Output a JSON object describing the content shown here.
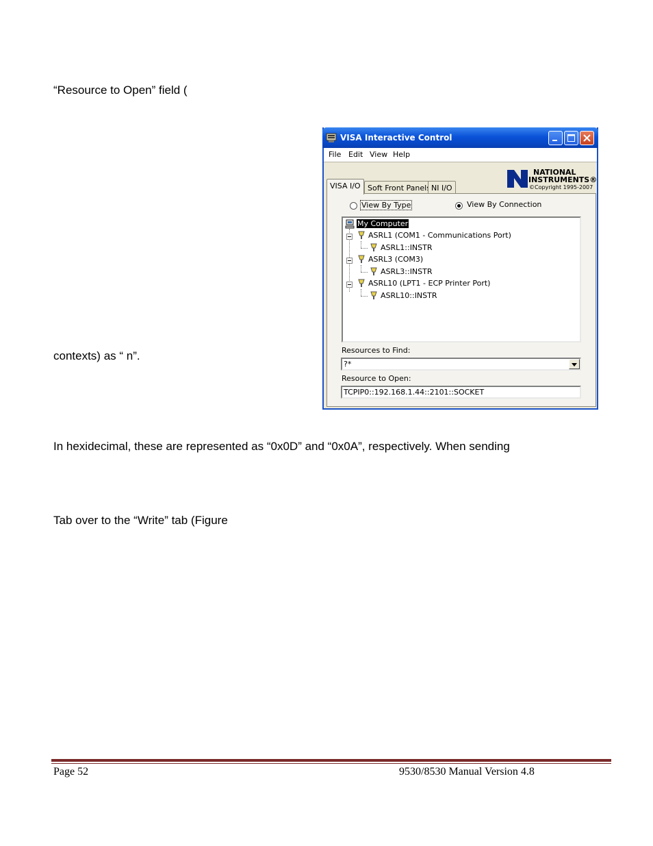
{
  "document": {
    "para1": "“Resource to Open” field (",
    "para2": "contexts) as “   n”.",
    "para3": "In hexidecimal, these are represented as “0x0D” and “0x0A”, respectively.  When sending",
    "para4": "Tab over to the “Write” tab (Figure"
  },
  "window": {
    "title": "VISA Interactive Control",
    "menu": [
      "File",
      "Edit",
      "View",
      "Help"
    ],
    "logo": {
      "line1": "NATIONAL",
      "line2": "INSTRUMENTS®",
      "copyright": "©Copyright 1995-2007"
    },
    "tabs": [
      {
        "label": "VISA I/O",
        "active": true
      },
      {
        "label": "Soft Front Panels",
        "active": false
      },
      {
        "label": "NI I/O",
        "active": false
      }
    ],
    "radios": [
      {
        "label": "View By Type",
        "selected": false
      },
      {
        "label": "View By Connection",
        "selected": true
      }
    ],
    "tree": [
      {
        "label": "My Computer",
        "icon": "computer-icon",
        "selected": true
      },
      {
        "label": "ASRL1  (COM1 - Communications Port)",
        "icon": "serial-connector-icon"
      },
      {
        "label": "ASRL1::INSTR",
        "icon": "instrument-icon"
      },
      {
        "label": "ASRL3  (COM3)",
        "icon": "serial-connector-icon"
      },
      {
        "label": "ASRL3::INSTR",
        "icon": "instrument-icon"
      },
      {
        "label": "ASRL10  (LPT1 - ECP Printer Port)",
        "icon": "serial-connector-icon"
      },
      {
        "label": "ASRL10::INSTR",
        "icon": "instrument-icon"
      }
    ],
    "resources_to_find": {
      "label": "Resources to Find:",
      "value": "?*"
    },
    "resource_to_open": {
      "label": "Resource to Open:",
      "value": "TCPIP0::192.168.1.44::2101::SOCKET"
    }
  },
  "footer": {
    "page": "Page 52",
    "version": "9530/8530 Manual Version 4.8"
  },
  "colors": {
    "title_bar": "#0a52d8",
    "footer_rule": "#7b2a2a",
    "window_face": "#ece9d8"
  }
}
